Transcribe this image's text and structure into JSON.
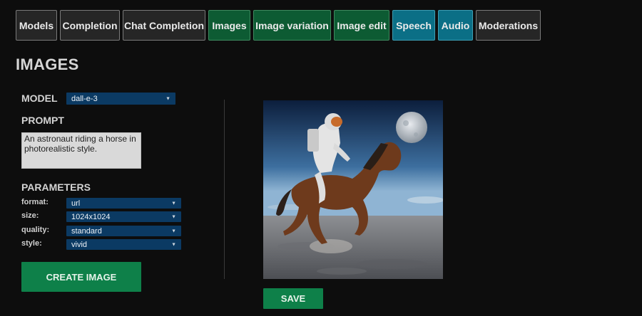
{
  "tabs": [
    {
      "label": "Models",
      "style": "gray"
    },
    {
      "label": "Completion",
      "style": "gray"
    },
    {
      "label": "Chat Completion",
      "style": "gray"
    },
    {
      "label": "Images",
      "style": "green"
    },
    {
      "label": "Image variation",
      "style": "green"
    },
    {
      "label": "Image edit",
      "style": "green"
    },
    {
      "label": "Speech",
      "style": "teal"
    },
    {
      "label": "Audio",
      "style": "teal"
    },
    {
      "label": "Moderations",
      "style": "gray"
    }
  ],
  "page_title": "IMAGES",
  "form": {
    "model_label": "MODEL",
    "model_value": "dall-e-3",
    "prompt_label": "PROMPT",
    "prompt_value": "An astronaut riding a horse in photorealistic style.",
    "parameters_label": "PARAMETERS",
    "params": [
      {
        "label": "format:",
        "value": "url"
      },
      {
        "label": "size:",
        "value": "1024x1024"
      },
      {
        "label": "quality:",
        "value": "standard"
      },
      {
        "label": "style:",
        "value": "vivid"
      }
    ],
    "create_button": "CREATE IMAGE"
  },
  "result": {
    "image_icon": "generated-image-astronaut-horse",
    "save_button": "SAVE"
  },
  "colors": {
    "background": "#0d0d0d",
    "tab_gray": "#262626",
    "tab_green": "#0d5b33",
    "tab_teal": "#0b6f86",
    "select_bg": "#0b3a63",
    "button_green": "#0e8049"
  }
}
